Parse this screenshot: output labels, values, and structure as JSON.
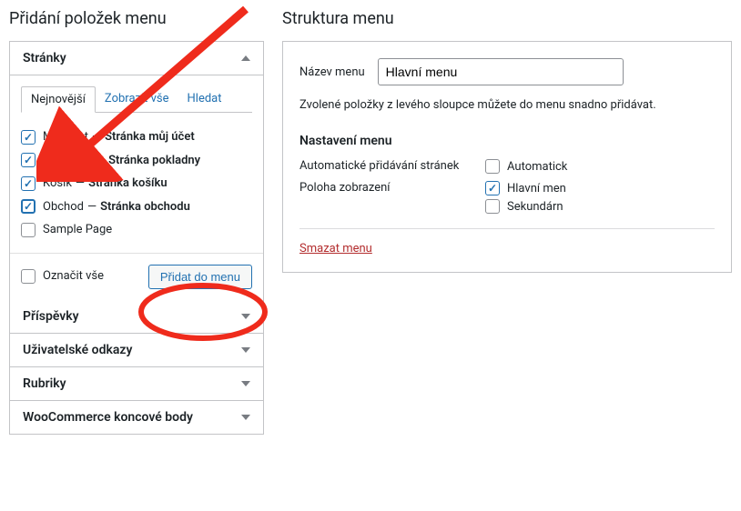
{
  "left": {
    "heading": "Přidání položek menu",
    "accordions": {
      "pages": {
        "title": "Stránky",
        "tabs": {
          "recent": "Nejnovější",
          "all": "Zobrazit vše",
          "search": "Hledat"
        },
        "items": [
          {
            "checked": true,
            "label": "Můj účet",
            "suffix": "Stránka můj účet"
          },
          {
            "checked": true,
            "label": "Pokladna",
            "suffix": "Stránka pokladny"
          },
          {
            "checked": true,
            "label": "Košík",
            "suffix": "Stránka košíku"
          },
          {
            "checked": true,
            "bold": true,
            "label": "Obchod",
            "suffix": "Stránka obchodu"
          },
          {
            "checked": false,
            "label": "Sample Page",
            "suffix": ""
          }
        ],
        "select_all": "Označit vše",
        "add_button": "Přidat do menu"
      },
      "posts": {
        "title": "Příspěvky"
      },
      "custom": {
        "title": "Uživatelské odkazy"
      },
      "cats": {
        "title": "Rubriky"
      },
      "woo": {
        "title": "WooCommerce koncové body"
      }
    }
  },
  "right": {
    "heading": "Struktura menu",
    "name_label": "Název menu",
    "name_value": "Hlavní menu",
    "desc": "Zvolené položky z levého sloupce můžete do menu snadno přidávat.",
    "settings_heading": "Nastavení menu",
    "auto_add_label": "Automatické přidávání stránek",
    "auto_add_option": "Automatick",
    "location_label": "Poloha zobrazení",
    "location_options": [
      {
        "checked": true,
        "label": "Hlavní men"
      },
      {
        "checked": false,
        "label": "Sekundárn"
      }
    ],
    "delete": "Smazat menu"
  }
}
